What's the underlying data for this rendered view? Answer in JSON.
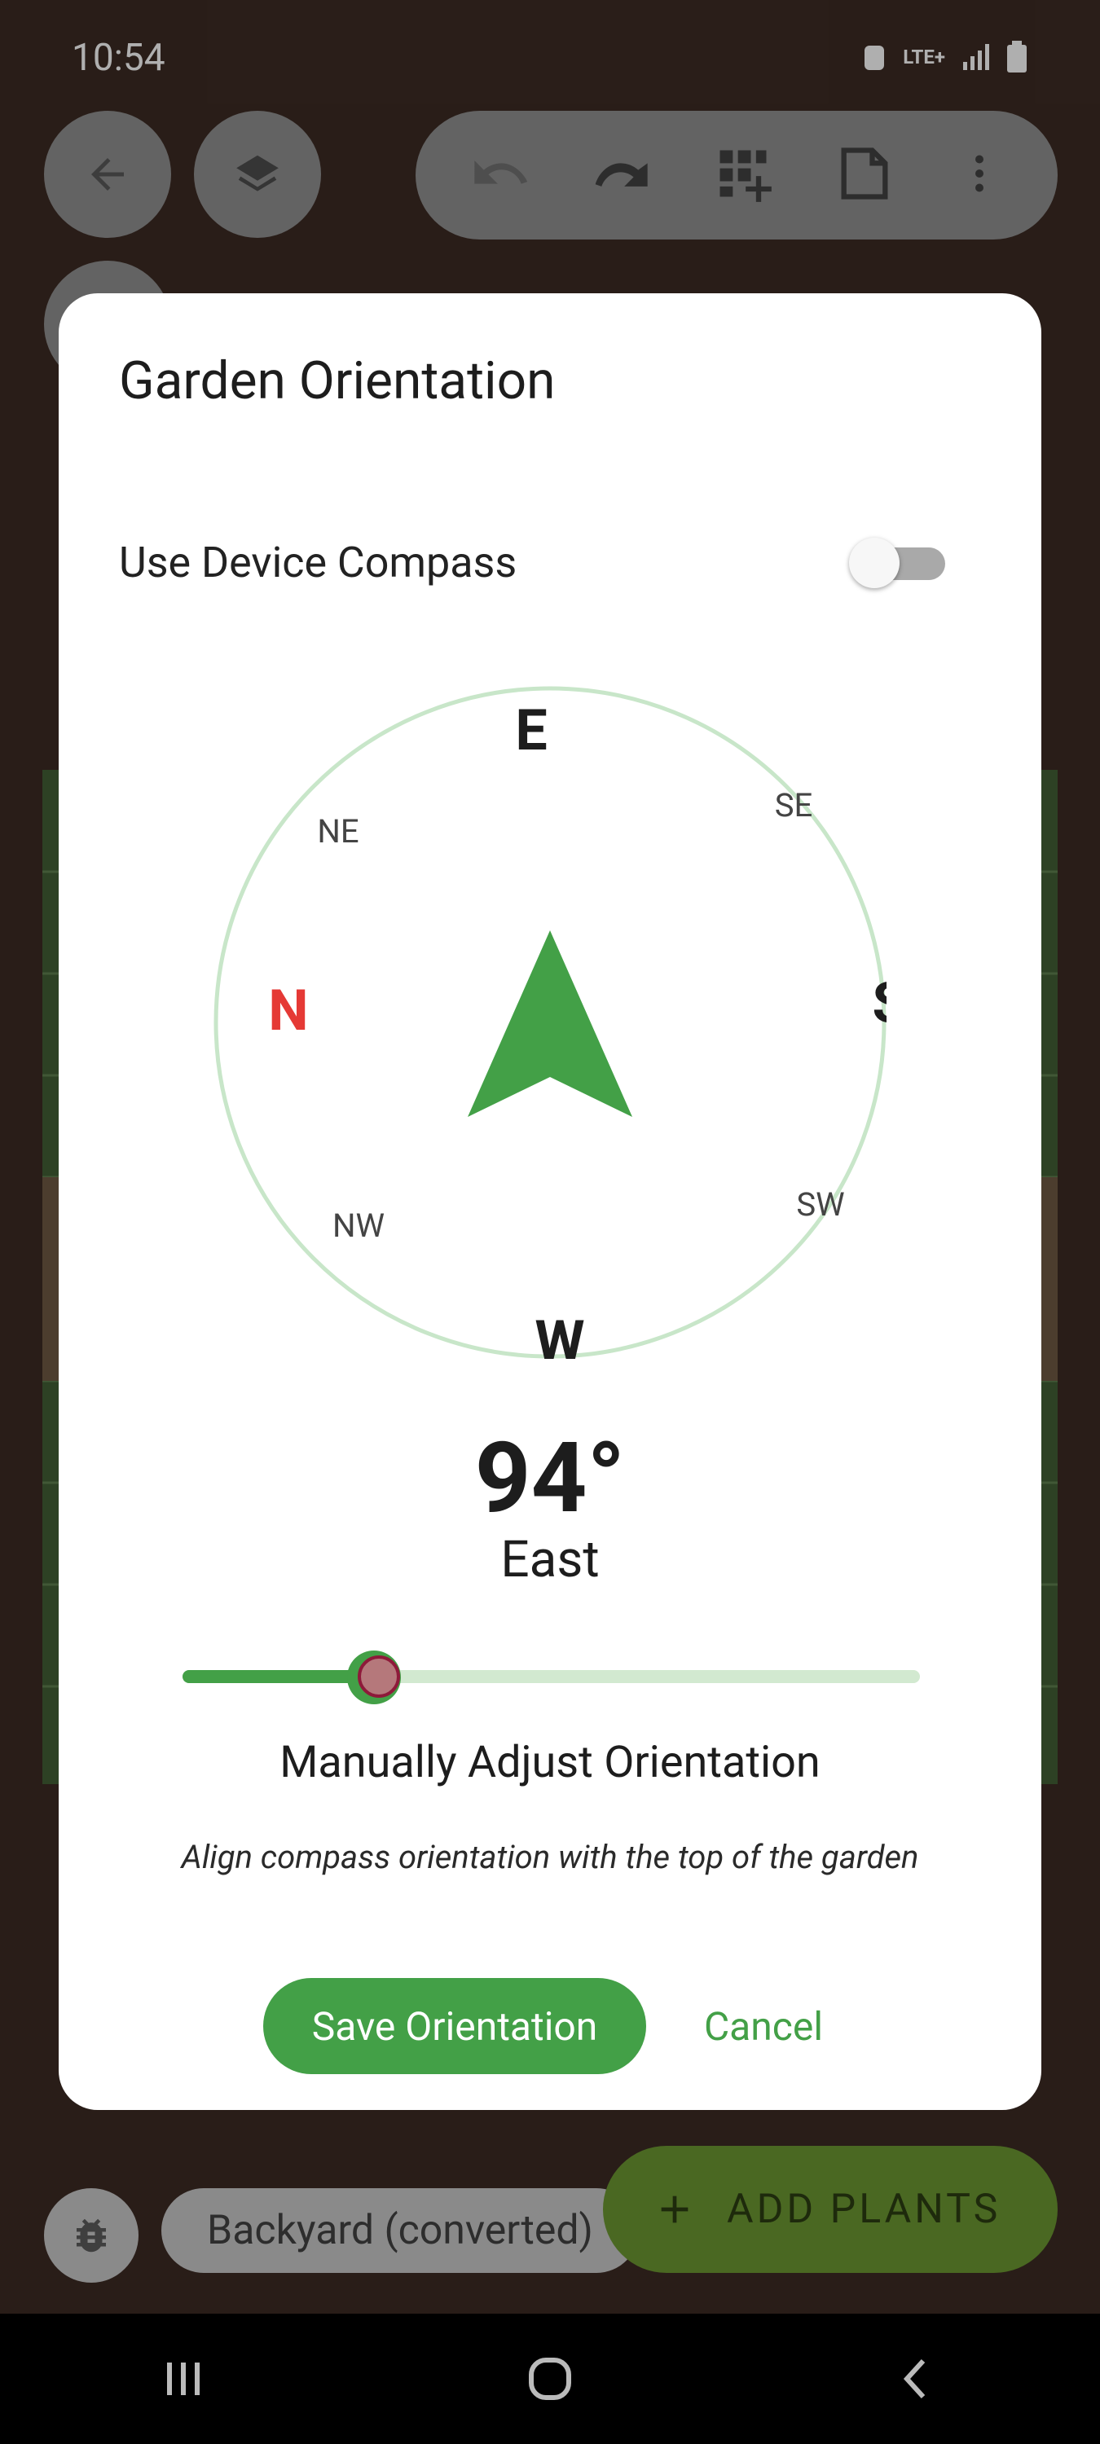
{
  "status_bar": {
    "time": "10:54",
    "network": "LTE+"
  },
  "toolbar": {
    "back_icon": "arrow-left-icon",
    "layers_icon": "layers-icon",
    "undo_icon": "undo-icon",
    "redo_icon": "redo-icon",
    "add_grid_icon": "grid-add-icon",
    "page_icon": "page-icon",
    "more_icon": "more-vert-icon"
  },
  "dialog": {
    "title": "Garden Orientation",
    "use_compass_label": "Use Device Compass",
    "use_compass_on": false,
    "compass": {
      "labels": {
        "top": "E",
        "top_right": "SE",
        "right": "S",
        "bottom_right": "SW",
        "bottom": "W",
        "bottom_left": "NW",
        "left": "N",
        "top_left": "NE"
      },
      "north_color": "#e53935",
      "ring_color": "#c8e6c9",
      "arrow_color": "#43a047"
    },
    "degrees": "94°",
    "direction": "East",
    "slider_fraction": 0.26,
    "manual_label": "Manually Adjust Orientation",
    "hint": "Align compass orientation with the top of the garden",
    "save_label": "Save Orientation",
    "cancel_label": "Cancel"
  },
  "bottom": {
    "garden_name": "Backyard (converted)",
    "add_plants_label": "ADD PLANTS",
    "bug_icon": "bug-icon",
    "accent": "#43a047"
  }
}
